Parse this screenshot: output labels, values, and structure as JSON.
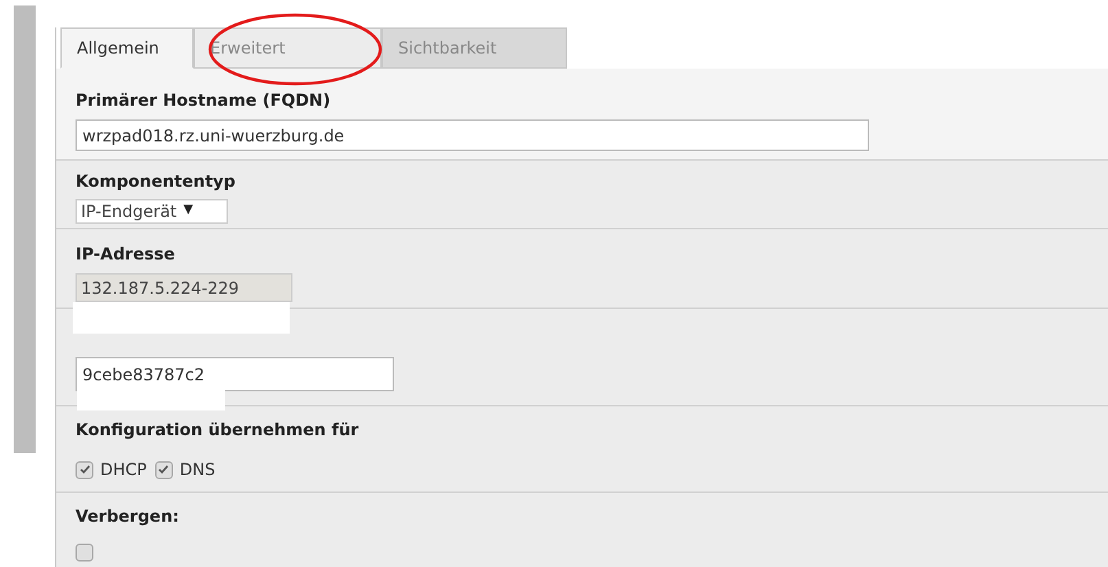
{
  "tabs": [
    {
      "label": "Allgemein",
      "selected": true,
      "highlighted": false
    },
    {
      "label": "Erweitert",
      "selected": false,
      "highlighted": true
    },
    {
      "label": "Sichtbarkeit",
      "selected": false,
      "highlighted": false
    }
  ],
  "sections": [
    {
      "kind": "text",
      "label": "Primärer Hostname (FQDN)",
      "value": "wrzpad018.rz.uni-wuerzburg.de"
    },
    {
      "kind": "select",
      "label": "Komponententyp",
      "value": "IP-Endgerät",
      "caret": "▼"
    },
    {
      "kind": "readonly",
      "label": "IP-Adresse",
      "value": "132.187.5.224-229"
    },
    {
      "kind": "mac",
      "value": "9cebe83787c2"
    },
    {
      "kind": "checks",
      "label": "Konfiguration übernehmen für",
      "options": [
        {
          "label": "DHCP",
          "checked": true
        },
        {
          "label": "DNS",
          "checked": true
        }
      ]
    },
    {
      "kind": "checks",
      "label": "Verbergen:",
      "options": [
        {
          "checked": false
        }
      ]
    }
  ]
}
